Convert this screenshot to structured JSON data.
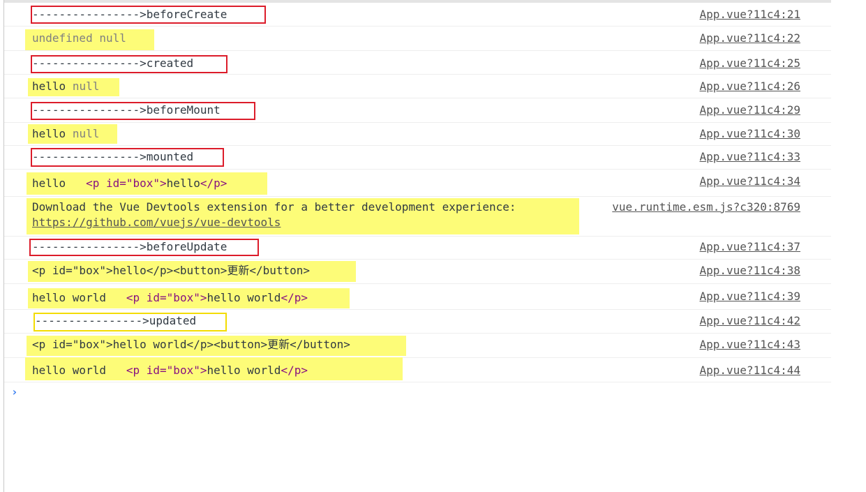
{
  "console": {
    "logs": {
      "before_create": {
        "text": "---------------->beforeCreate",
        "source": "App.vue?11c4:21"
      },
      "undefined_null": {
        "a": "undefined",
        "b": "null",
        "source": "App.vue?11c4:22"
      },
      "created": {
        "text": "---------------->created",
        "source": "App.vue?11c4:25"
      },
      "hello_null_1": {
        "a": "hello",
        "b": "null",
        "source": "App.vue?11c4:26"
      },
      "before_mount": {
        "text": "---------------->beforeMount",
        "source": "App.vue?11c4:29"
      },
      "hello_null_2": {
        "a": "hello",
        "b": "null",
        "source": "App.vue?11c4:30"
      },
      "mounted": {
        "text": "---------------->mounted",
        "source": "App.vue?11c4:33"
      },
      "hello_box": {
        "a": "hello",
        "el_open": "<p id=\"box\">",
        "el_text": "hello",
        "el_close": "</p>",
        "source": "App.vue?11c4:34"
      },
      "devtools": {
        "line1": "Download the Vue Devtools extension for a better development experience:",
        "link": "https://github.com/vuejs/vue-devtools",
        "source": "vue.runtime.esm.js?c320:8769"
      },
      "before_update": {
        "text": "---------------->beforeUpdate",
        "source": "App.vue?11c4:37"
      },
      "html_before": {
        "text": "<p id=\"box\">hello</p><button>更新</button>",
        "source": "App.vue?11c4:38"
      },
      "hello_world_1": {
        "a": "hello world",
        "el_open": "<p id=\"box\">",
        "el_text": "hello world",
        "el_close": "</p>",
        "source": "App.vue?11c4:39"
      },
      "updated": {
        "text": "---------------->updated",
        "source": "App.vue?11c4:42"
      },
      "html_after": {
        "text": "<p id=\"box\">hello world</p><button>更新</button>",
        "source": "App.vue?11c4:43"
      },
      "hello_world_2": {
        "a": "hello world",
        "el_open": "<p id=\"box\">",
        "el_text": "hello world",
        "el_close": "</p>",
        "source": "App.vue?11c4:44"
      }
    },
    "prompt_symbol": "›"
  },
  "colors": {
    "highlight": "#fdfc78",
    "box_red": "#dc1c2a",
    "box_yellow": "#f3dc00",
    "prompt": "#367cf1"
  }
}
